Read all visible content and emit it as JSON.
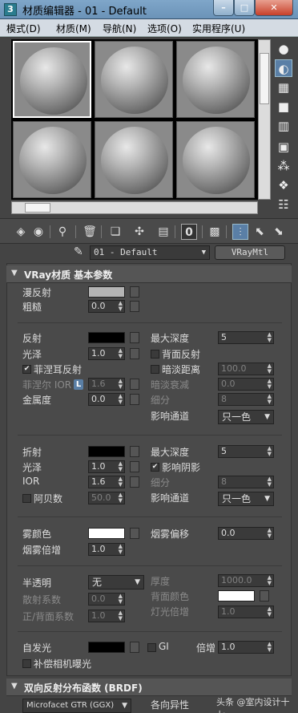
{
  "window": {
    "title": "材质编辑器 - 01 - Default",
    "app_icon_glyph": "3",
    "controls": {
      "minimize": "–",
      "maximize": "□",
      "close": "✕"
    }
  },
  "menu": [
    "模式(D)",
    "材质(M)",
    "导航(N)",
    "选项(O)",
    "实用程序(U)"
  ],
  "samples": {
    "rows": 2,
    "cols": 3,
    "active_index": 0
  },
  "side_toolbar_icons": [
    "sample-type-icon",
    "backlight-icon",
    "background-icon",
    "uv-tiling-icon",
    "video-color-check-icon",
    "preview-icon",
    "options-icon",
    "select-by-material-icon",
    "material-map-navigator-icon"
  ],
  "bottom_toolbar_icons": [
    "get-material-icon",
    "put-to-scene-icon",
    "assign-to-selection-icon",
    "reset-map-icon",
    "make-unique-icon",
    "put-to-library-icon",
    "material-id-channel-icon",
    "show-shaded-map-icon",
    "show-end-result-icon",
    "go-to-parent-icon",
    "go-forward-icon"
  ],
  "material_id_value": "0",
  "material": {
    "name": "01 - Default",
    "type": "VRayMtl"
  },
  "colors": {
    "diffuse": "#b4b4b4",
    "reflect": "#000000",
    "refract": "#000000",
    "fog": "#ffffff",
    "back_color": "#ffffff",
    "self_illum": "#000000",
    "accent": "#5a7fa6"
  },
  "basic": {
    "header": "VRay材质 基本参数",
    "diffuse_label": "漫反射",
    "roughness_label": "粗糙",
    "roughness_value": "0.0",
    "reflect_label": "反射",
    "gloss_label": "光泽",
    "gloss_value": "1.0",
    "fresnel_label": "菲涅耳反射",
    "fresnel_ior_label": "菲涅尔 IOR",
    "fresnel_ior_lock": "L",
    "fresnel_ior_value": "1.6",
    "metal_label": "金属度",
    "metal_value": "0.0",
    "max_depth_label": "最大深度",
    "max_depth_value": "5",
    "back_reflect_label": "背面反射",
    "dim_dist_label": "暗淡距离",
    "dim_dist_value": "100.0",
    "dim_falloff_label": "暗淡衰减",
    "dim_falloff_value": "0.0",
    "subdivs_label": "细分",
    "subdivs_value": "8",
    "affect_ch_label": "影响通道",
    "affect_ch_value": "只一色",
    "refract_label": "折射",
    "refr_gloss_label": "光泽",
    "refr_gloss_value": "1.0",
    "ior_label": "IOR",
    "ior_value": "1.6",
    "abbe_label": "阿贝数",
    "abbe_value": "50.0",
    "refr_max_depth_label": "最大深度",
    "refr_max_depth_value": "5",
    "affect_shadows_label": "影响阴影",
    "refr_subdivs_label": "细分",
    "refr_subdivs_value": "8",
    "refr_affect_ch_label": "影响通道",
    "refr_affect_ch_value": "只一色",
    "fog_color_label": "雾颜色",
    "fog_bias_label": "烟雾偏移",
    "fog_bias_value": "0.0",
    "fog_mult_label": "烟雾倍增",
    "fog_mult_value": "1.0",
    "translucency_label": "半透明",
    "translucency_value": "无",
    "scatter_label": "散射系数",
    "scatter_value": "0.0",
    "fwd_back_label": "正/背面系数",
    "fwd_back_value": "1.0",
    "thickness_label": "厚度",
    "thickness_value": "1000.0",
    "back_color_label": "背面颜色",
    "light_mult_label": "灯光倍增",
    "light_mult_value": "1.0",
    "self_illum_label": "自发光",
    "gi_label": "GI",
    "mult_label": "倍增",
    "mult_value": "1.0",
    "comp_cam_label": "补偿相机曝光"
  },
  "brdf": {
    "header": "双向反射分布函数 (BRDF)",
    "type_value": "Microfacet GTR (GGX)",
    "anisotropy_label": "各向异性"
  },
  "watermark": "头条 @室内设计十七"
}
